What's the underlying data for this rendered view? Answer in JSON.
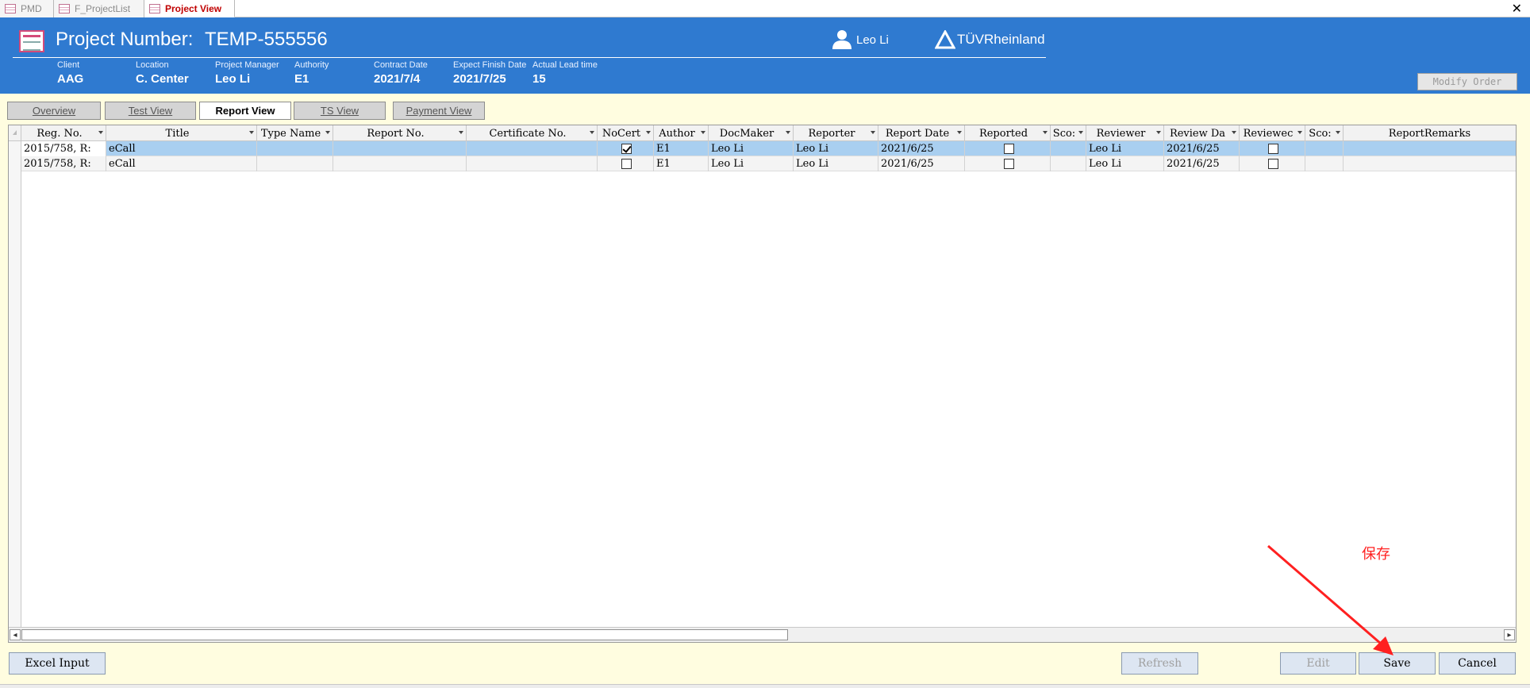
{
  "window": {
    "tabs": [
      {
        "label": "PMD"
      },
      {
        "label": "F_ProjectList"
      },
      {
        "label": "Project View"
      }
    ],
    "close_glyph": "✕"
  },
  "header": {
    "project_label": "Project Number:",
    "project_number": "TEMP-555556",
    "user": "Leo Li",
    "logo_text": "TÜVRheinland",
    "fields": [
      {
        "label": "Client",
        "value": "AAG"
      },
      {
        "label": "Location",
        "value": "C. Center"
      },
      {
        "label": "Project Manager",
        "value": "Leo Li"
      },
      {
        "label": "Authority",
        "value": "E1"
      },
      {
        "label": "Contract Date",
        "value": "2021/7/4"
      },
      {
        "label": "Expect Finish Date",
        "value": "2021/7/25"
      },
      {
        "label": "Actual Lead time",
        "value": "15"
      }
    ],
    "modify_label": "Modify Order",
    "brand_color": "#2f7ad0"
  },
  "view_tabs": [
    {
      "label": "Overview"
    },
    {
      "label": "Test View"
    },
    {
      "label": "Report View"
    },
    {
      "label": "TS View"
    },
    {
      "label": "Payment View"
    }
  ],
  "grid": {
    "columns": [
      "Reg. No.",
      "Title",
      "Type Name",
      "Report No.",
      "Certificate No.",
      "NoCert",
      "Author",
      "DocMaker",
      "Reporter",
      "Report Date",
      "Reported",
      "Sco:",
      "Reviewer",
      "Review Da",
      "Reviewec",
      "Sco:",
      "ReportRemarks"
    ],
    "rows": [
      {
        "reg_no": "2015/758, R:",
        "title": "eCall",
        "type_name": "",
        "report_no": "",
        "cert_no": "",
        "nocert": true,
        "author": "E1",
        "docmaker": "Leo Li",
        "reporter": "Leo Li",
        "report_date": "2021/6/25",
        "reported": false,
        "score1": "",
        "reviewer": "Leo Li",
        "review_date": "2021/6/25",
        "reviewed": false,
        "score2": "",
        "remarks": ""
      },
      {
        "reg_no": "2015/758, R:",
        "title": "eCall",
        "type_name": "",
        "report_no": "",
        "cert_no": "",
        "nocert": false,
        "author": "E1",
        "docmaker": "Leo Li",
        "reporter": "Leo Li",
        "report_date": "2021/6/25",
        "reported": false,
        "score1": "",
        "reviewer": "Leo Li",
        "review_date": "2021/6/25",
        "reviewed": false,
        "score2": "",
        "remarks": ""
      }
    ],
    "selected_row_color": "#a9cff0"
  },
  "buttons": {
    "excel_input": "Excel Input",
    "refresh": "Refresh",
    "edit": "Edit",
    "save": "Save",
    "cancel": "Cancel"
  },
  "annotation": {
    "text": "保存",
    "color": "#ff2020"
  }
}
